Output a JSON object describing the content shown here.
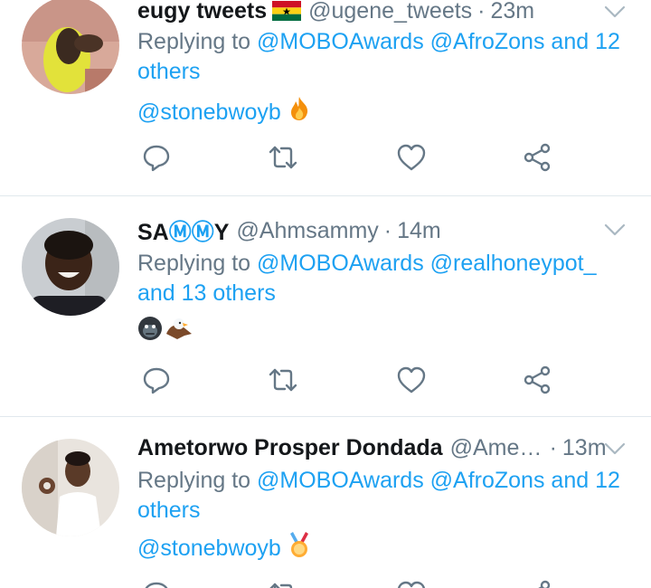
{
  "tweets": [
    {
      "name": "eugy tweets",
      "flag": "ghana-flag",
      "handle": "@ugene_tweets",
      "dot": "·",
      "time": "23m",
      "reply_prefix": "Replying to ",
      "reply_mentions": "@MOBOAwards @AfroZons",
      "reply_suffix": " and 12 others",
      "body_mention": "@stonebwoyb",
      "body_emoji": "fire-emoji"
    },
    {
      "name_parts": [
        "SA",
        "Ⓜ",
        "Ⓜ",
        "Y"
      ],
      "handle": "@Ahmsammy",
      "dot": "·",
      "time": "14m",
      "reply_prefix": "Replying to ",
      "reply_mentions": "@MOBOAwards @realhoneypot_",
      "reply_suffix": " and 13 others",
      "body_emoji": [
        "gorilla-emoji",
        "eagle-emoji"
      ]
    },
    {
      "name": "Ametorwo Prosper Dondada",
      "handle": "@Amet…",
      "dot": "·",
      "time": "13m",
      "reply_prefix": "Replying to ",
      "reply_mentions": "@MOBOAwards @AfroZons",
      "reply_suffix": " and 12 others",
      "body_mention": "@stonebwoyb",
      "body_emoji": "medal-emoji"
    }
  ],
  "colors": {
    "link": "#1da1f2",
    "secondary": "#657786",
    "text": "#14171a",
    "divider": "#e1e8ed",
    "icon": "#657786"
  },
  "icons": [
    "reply-icon",
    "retweet-icon",
    "like-icon",
    "share-icon",
    "chevron-down-icon"
  ]
}
